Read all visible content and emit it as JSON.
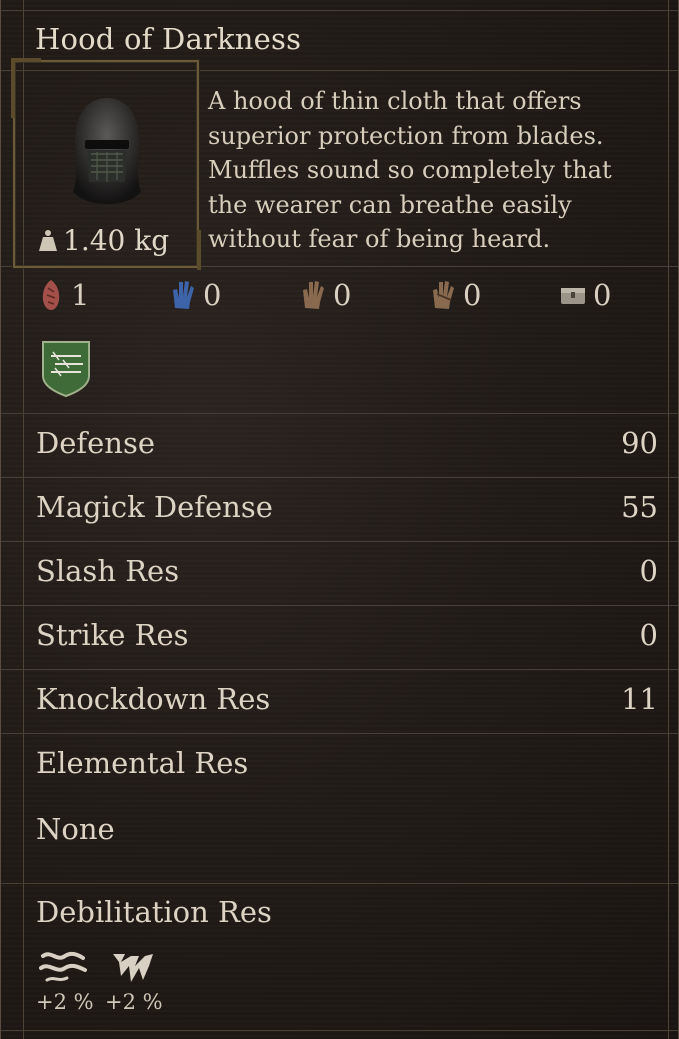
{
  "item": {
    "name": "Hood of Darkness",
    "weight": "1.40 kg",
    "description_lines": [
      "A hood of thin cloth that offers",
      "superior protection from blades.",
      "Muffles sound so completely that",
      "the wearer can breathe easily",
      "without fear of being heard."
    ]
  },
  "vocation_stats": [
    {
      "icon": "red-hand-icon",
      "value": "1",
      "color": "#a3504a"
    },
    {
      "icon": "blue-hand-icon",
      "value": "0",
      "color": "#3d63a8"
    },
    {
      "icon": "brown-hand-icon",
      "value": "0",
      "color": "#8a6a4e"
    },
    {
      "icon": "brown-hand-icon",
      "value": "0",
      "color": "#8a6a4e"
    },
    {
      "icon": "chest-icon",
      "value": "0",
      "color": "#9c9488"
    }
  ],
  "attributes": [
    {
      "label": "Defense",
      "value": "90"
    },
    {
      "label": "Magick Defense",
      "value": "55"
    },
    {
      "label": "Slash Res",
      "value": "0"
    },
    {
      "label": "Strike Res",
      "value": "0"
    },
    {
      "label": "Knockdown Res",
      "value": "11"
    }
  ],
  "elemental": {
    "label": "Elemental Res",
    "value": "None"
  },
  "debilitation": {
    "label": "Debilitation Res",
    "items": [
      {
        "icon": "wind-icon",
        "value": "+2 %"
      },
      {
        "icon": "claw-icon",
        "value": "+2 %"
      }
    ]
  },
  "colors": {
    "background": "#221c18",
    "divider": "#4a3f35",
    "text": "#d9d0c1",
    "frame": "#6a5a3a"
  }
}
